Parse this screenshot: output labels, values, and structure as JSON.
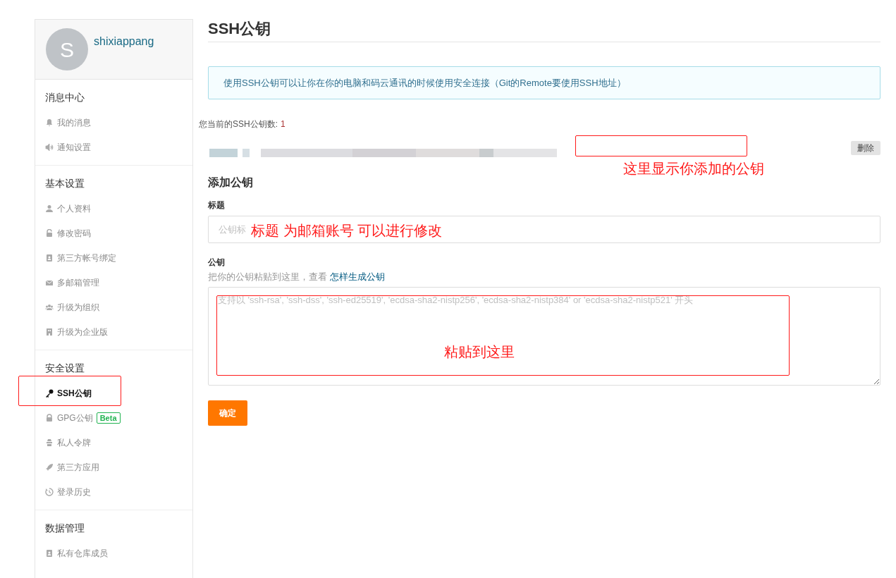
{
  "sidebar": {
    "user": {
      "avatar_letter": "S",
      "name": "shixiappang"
    },
    "sections": [
      {
        "title": "消息中心",
        "items": [
          {
            "label": "我的消息",
            "selected": false
          },
          {
            "label": "通知设置",
            "selected": false
          }
        ]
      },
      {
        "title": "基本设置",
        "items": [
          {
            "label": "个人资料",
            "selected": false
          },
          {
            "label": "修改密码",
            "selected": false
          },
          {
            "label": "第三方帐号绑定",
            "selected": false
          },
          {
            "label": "多邮箱管理",
            "selected": false
          },
          {
            "label": "升级为组织",
            "selected": false
          },
          {
            "label": "升级为企业版",
            "selected": false
          }
        ]
      },
      {
        "title": "安全设置",
        "items": [
          {
            "label": "SSH公钥",
            "selected": true
          },
          {
            "label": "GPG公钥",
            "selected": false,
            "badge": "Beta"
          },
          {
            "label": "私人令牌",
            "selected": false
          },
          {
            "label": "第三方应用",
            "selected": false
          },
          {
            "label": "登录历史",
            "selected": false
          }
        ]
      },
      {
        "title": "数据管理",
        "items": [
          {
            "label": "私有仓库成员",
            "selected": false
          }
        ]
      }
    ]
  },
  "page": {
    "title": "SSH公钥",
    "notice": "使用SSH公钥可以让你在你的电脑和码云通讯的时候使用安全连接（Git的Remote要使用SSH地址）",
    "key_count_label": "您当前的SSH公钥数:",
    "key_count": "1",
    "keys": [
      {
        "kind": "picture",
        "delete_button": "删除"
      }
    ],
    "form": {
      "heading": "添加公钥",
      "title_label": "标题",
      "title_placeholder": "公钥标",
      "key_label": "公钥",
      "key_help": "把你的公钥粘贴到这里，查看",
      "key_help_link": "怎样生成公钥",
      "key_placeholder": "支持以 'ssh-rsa', 'ssh-dss', 'ssh-ed25519', 'ecdsa-sha2-nistp256', 'ecdsa-sha2-nistp384' or 'ecdsa-sha2-nistp521' 开头",
      "submit": "确定"
    }
  },
  "annotations": [
    {
      "kind": "box"
    },
    {
      "kind": "box"
    },
    {
      "kind": "note",
      "text": "这里显示你添加的公钥"
    },
    {
      "kind": "note",
      "text": "标题 为邮箱账号 可以进行修改"
    },
    {
      "kind": "box"
    },
    {
      "kind": "note",
      "text": "粘贴到这里"
    }
  ]
}
